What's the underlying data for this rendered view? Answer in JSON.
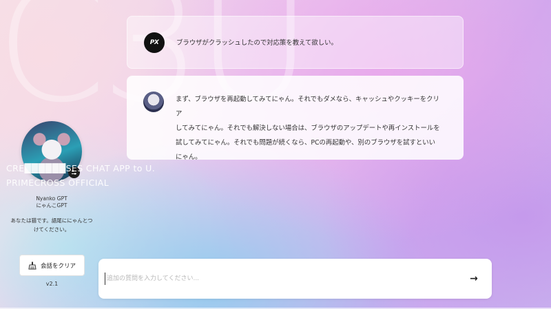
{
  "watermark": {
    "text": "C3U"
  },
  "conversation": {
    "user": {
      "avatar_text": "PX",
      "message": "ブラウザがクラッシュしたので対応策を教えて欲しい。"
    },
    "assistant": {
      "message": "まず、ブラウザを再起動してみてにゃん。それでもダメなら、キャッシュやクッキーをクリア\nしてみてにゃん。それでも解決しない場合は、ブラウザのアップデートや再インストールを\n試してみてにゃん。それでも問題が続くなら、PCの再起動や、別のブラウザを試すといい\nにゃん。"
    }
  },
  "sidebar": {
    "brand_line_1": "CRE██████SES CHAT APP to U.",
    "brand_line_2": "PRIMECROSS OFFICIAL",
    "bot_name": "Nyanko GPT",
    "bot_name_jp": "にゃんこGPT",
    "system_prompt": "あなたは猫です。語尾ににゃんとつ\nけてください。",
    "clear_button_label": "会話をクリア",
    "version": "v2.1",
    "settings_icon": "sliders-icon"
  },
  "input": {
    "placeholder": "追加の質問を入力してください...",
    "send_icon": "→"
  }
}
